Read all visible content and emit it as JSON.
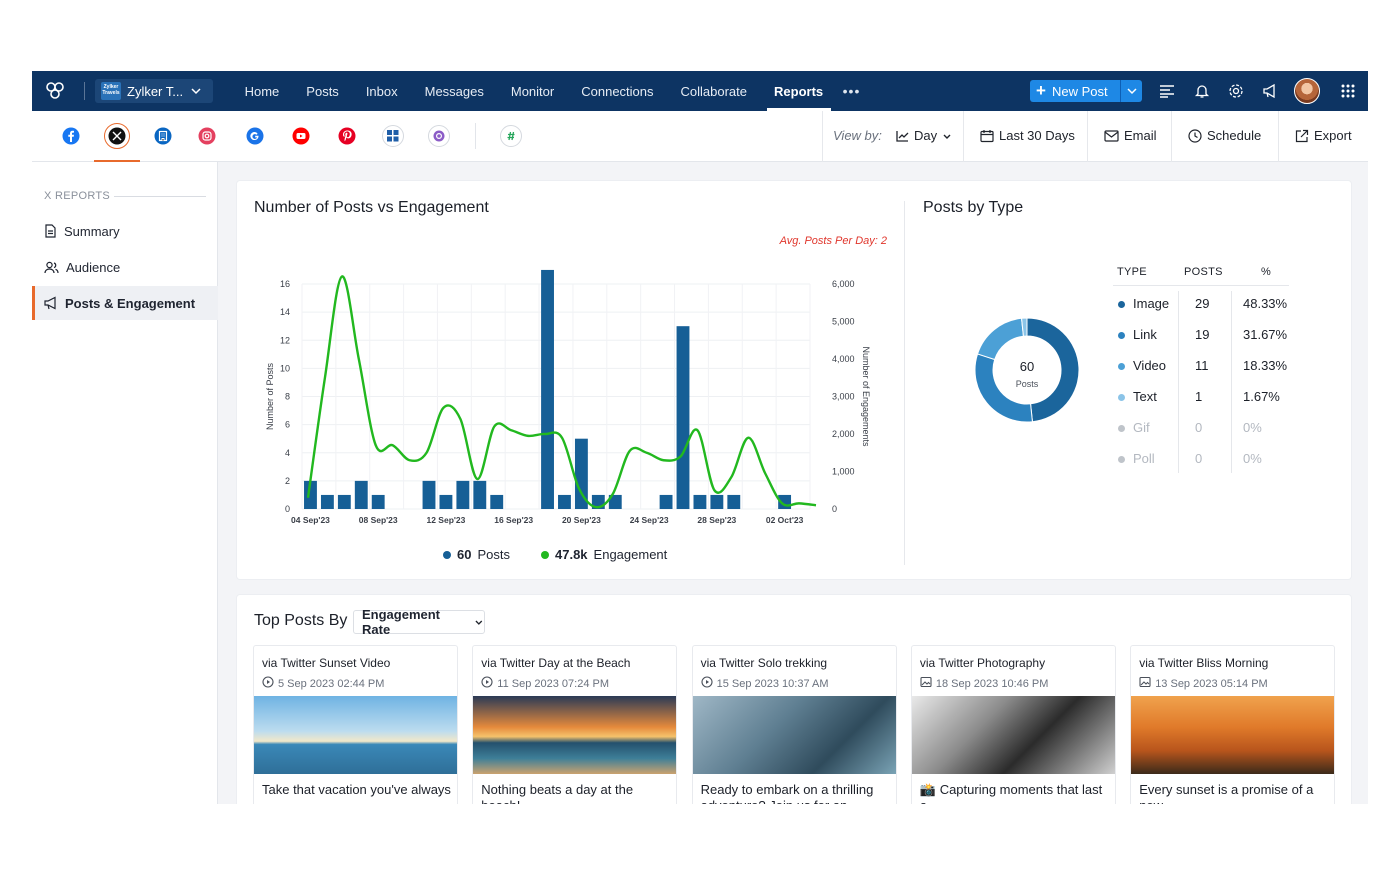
{
  "nav": {
    "brand": "Zylker T...",
    "brand_logo": "Zylker Travels",
    "items": [
      {
        "label": "Home"
      },
      {
        "label": "Posts"
      },
      {
        "label": "Inbox"
      },
      {
        "label": "Messages"
      },
      {
        "label": "Monitor"
      },
      {
        "label": "Connections"
      },
      {
        "label": "Collaborate"
      },
      {
        "label": "Reports",
        "active": true
      }
    ],
    "more": "•••",
    "new_post": "New Post",
    "icons": [
      "lines-icon",
      "bell-icon",
      "gear-icon",
      "megaphone-icon",
      "avatar",
      "apps-grid-icon"
    ]
  },
  "toolbar": {
    "networks": [
      "facebook-icon",
      "x-icon",
      "linkedin-company-icon",
      "instagram-icon",
      "google-business-icon",
      "youtube-icon",
      "pinterest-icon",
      "microsoft-icon",
      "threads-icon",
      "zoho-icon"
    ],
    "active_network": "x-icon",
    "view_by": "View by:",
    "granularity": "Day",
    "range": "Last 30 Days",
    "email": "Email",
    "schedule": "Schedule",
    "export": "Export"
  },
  "sidebar": {
    "heading": "X REPORTS",
    "items": [
      {
        "label": "Summary",
        "icon": "document-icon"
      },
      {
        "label": "Audience",
        "icon": "users-icon"
      },
      {
        "label": "Posts & Engagement",
        "icon": "megaphone-icon",
        "active": true
      }
    ]
  },
  "engagement_card": {
    "title": "Number of Posts vs Engagement",
    "avg_posts": "Avg. Posts Per Day: 2",
    "legend_posts_value": "60",
    "legend_posts_label": "Posts",
    "legend_eng_value": "47.8k",
    "legend_eng_label": "Engagement"
  },
  "chart_data": [
    {
      "type": "bar+line",
      "ylabel": "Number of Posts",
      "y2label": "Number of Engagements",
      "ylim": [
        0,
        16
      ],
      "y_ticks": [
        0,
        2,
        4,
        6,
        8,
        10,
        12,
        14,
        16
      ],
      "y2lim": [
        0,
        6000
      ],
      "y2_ticks": [
        "0",
        "1,000",
        "2,000",
        "3,000",
        "4,000",
        "5,000",
        "6,000"
      ],
      "x_tick_labels": [
        "04 Sep'23",
        "08 Sep'23",
        "12 Sep'23",
        "16 Sep'23",
        "20 Sep'23",
        "24 Sep'23",
        "28 Sep'23",
        "02 Oct'23"
      ],
      "grid": true,
      "colors": {
        "posts": "#165f96",
        "engagement": "#22b81f"
      },
      "series": [
        {
          "name": "Posts",
          "axis": "left",
          "type": "bar",
          "values": [
            2,
            1,
            1,
            2,
            1,
            0,
            0,
            2,
            1,
            2,
            2,
            1,
            0,
            0,
            17,
            1,
            5,
            1,
            1,
            0,
            0,
            1,
            13,
            1,
            1,
            1,
            0,
            0,
            1,
            0
          ]
        },
        {
          "name": "Engagement",
          "axis": "right",
          "type": "line",
          "values": [
            300,
            3500,
            6200,
            4000,
            1700,
            1700,
            1300,
            1500,
            2700,
            2400,
            800,
            2200,
            2100,
            1950,
            2000,
            1900,
            550,
            50,
            400,
            1550,
            1500,
            1300,
            1400,
            2100,
            500,
            850,
            1900,
            950,
            150,
            150,
            100
          ]
        }
      ]
    },
    {
      "type": "pie",
      "center_value": "60",
      "center_label": "Posts",
      "categories": [
        "Image",
        "Link",
        "Video",
        "Text",
        "Gif",
        "Poll"
      ],
      "values": [
        29,
        19,
        11,
        1,
        0,
        0
      ],
      "colors": [
        "#1b659c",
        "#2c82bf",
        "#4ca0d6",
        "#8bc4e8",
        "#bfc4ca",
        "#bfc4ca"
      ]
    }
  ],
  "type_card": {
    "title": "Posts by Type",
    "headers": [
      "TYPE",
      "POSTS",
      "%"
    ],
    "rows": [
      {
        "type": "Image",
        "posts": "29",
        "pct": "48.33%"
      },
      {
        "type": "Link",
        "posts": "19",
        "pct": "31.67%"
      },
      {
        "type": "Video",
        "posts": "11",
        "pct": "18.33%"
      },
      {
        "type": "Text",
        "posts": "1",
        "pct": "1.67%"
      },
      {
        "type": "Gif",
        "posts": "0",
        "pct": "0%"
      },
      {
        "type": "Poll",
        "posts": "0",
        "pct": "0%"
      }
    ]
  },
  "top_posts": {
    "title": "Top Posts By",
    "sort_by": "Engagement Rate",
    "posts": [
      {
        "source": "via Twitter Sunset Video",
        "date": "5 Sep 2023 02:44 PM",
        "kind": "video-icon",
        "caption": "Take that vacation you've always"
      },
      {
        "source": "via Twitter Day at the Beach",
        "date": "11 Sep 2023 07:24 PM",
        "kind": "video-icon",
        "caption": "Nothing beats a day at the beach!"
      },
      {
        "source": "via Twitter Solo trekking",
        "date": "15 Sep 2023 10:37 AM",
        "kind": "video-icon",
        "caption": "Ready to embark on a thrilling adventure? Join us for an"
      },
      {
        "source": "via Twitter Photography",
        "date": "18 Sep 2023 10:46 PM",
        "kind": "image-icon",
        "caption": "📸 Capturing moments that last a"
      },
      {
        "source": "via Twitter Bliss Morning",
        "date": "13 Sep 2023 05:14 PM",
        "kind": "image-icon",
        "caption": "Every sunset is a promise of a new"
      }
    ]
  }
}
